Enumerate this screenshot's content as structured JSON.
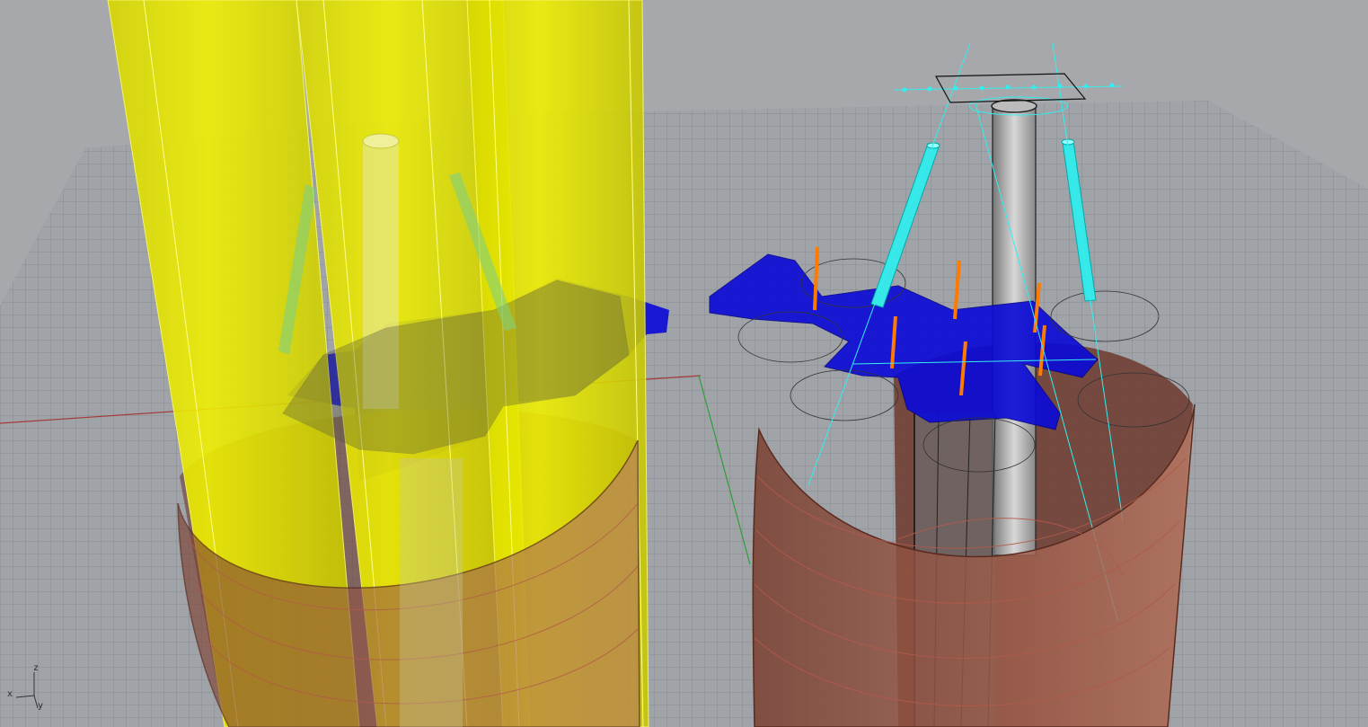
{
  "viewport": {
    "background": "#a6a8ab",
    "grid_color": "#7e8286",
    "grid_fill": "#9fa2a6",
    "x_axis_color": "#a33a3a",
    "y_axis_color": "#2e9e3a",
    "colors": {
      "yellow": "#e6e600",
      "blue": "#0a0ad8",
      "brown": "#8a4a38",
      "cyan": "#2ee0e0",
      "orange": "#ff7a00",
      "gray": "#9c9c9c"
    }
  },
  "axis_widget": {
    "z": "z",
    "x": "x",
    "y": "y"
  }
}
